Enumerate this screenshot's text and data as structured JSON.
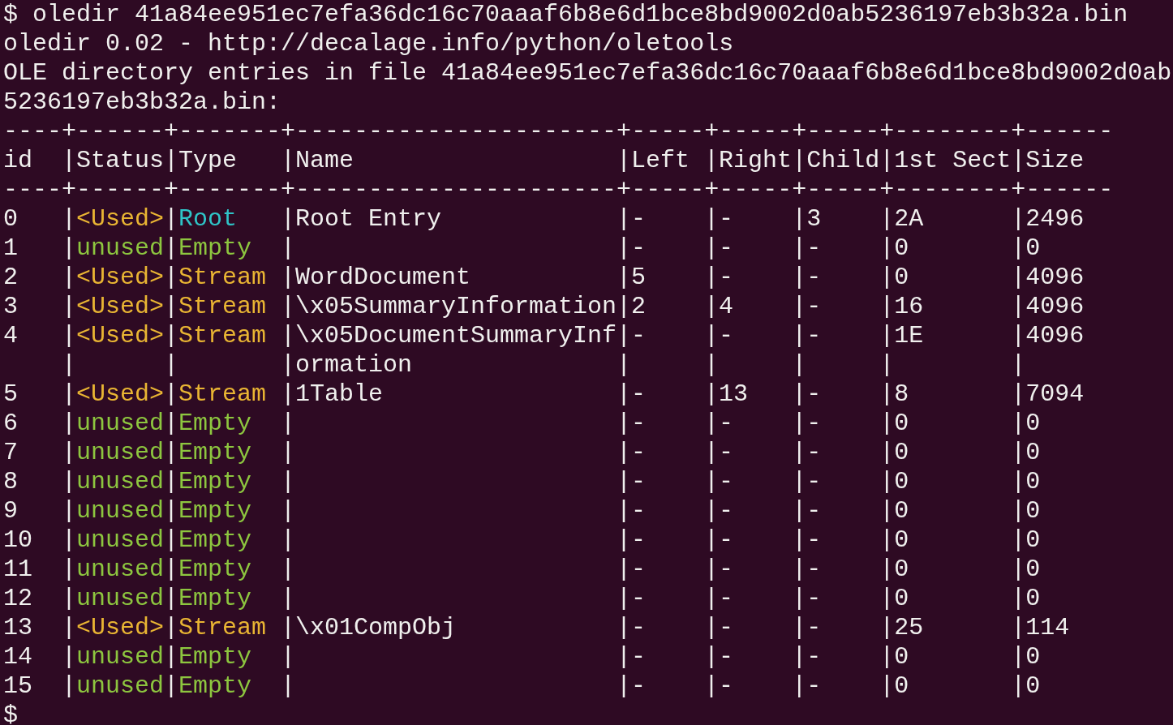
{
  "output_lines": [
    "$ oledir 41a84ee951ec7efa36dc16c70aaaf6b8e6d1bce8bd9002d0ab5236197eb3b32a.bin",
    "oledir 0.02 - http://decalage.info/python/oletools",
    "OLE directory entries in file 41a84ee951ec7efa36dc16c70aaaf6b8e6d1bce8bd9002d0ab",
    "5236197eb3b32a.bin:"
  ],
  "table": {
    "border_top": "----+------+-------+----------------------+-----+-----+-----+--------+------",
    "columns": [
      "id",
      "|Status",
      "|Type",
      "|Name",
      "|Left",
      "|Right",
      "|Child",
      "|1st Sect",
      "|Size"
    ],
    "border_bottom": "----+------+-------+----------------------+-----+-----+-----+--------+------",
    "rows": [
      {
        "cells": [
          "0",
          {
            "sep": "|",
            "text": "<Used>",
            "color": "#e9b533"
          },
          {
            "sep": "|",
            "text": "Root",
            "color": "#2fc5c8"
          },
          "|Root Entry",
          "|-",
          "|-",
          "|3",
          "|2A",
          "|2496"
        ]
      },
      {
        "cells": [
          "1",
          {
            "sep": "|",
            "text": "unused",
            "color": "#8dc63f"
          },
          {
            "sep": "|",
            "text": "Empty",
            "color": "#8dc63f"
          },
          "|",
          "|-",
          "|-",
          "|-",
          "|0",
          "|0"
        ]
      },
      {
        "cells": [
          "2",
          {
            "sep": "|",
            "text": "<Used>",
            "color": "#e9b533"
          },
          {
            "sep": "|",
            "text": "Stream",
            "color": "#e9b533"
          },
          "|WordDocument",
          "|5",
          "|-",
          "|-",
          "|0",
          "|4096"
        ]
      },
      {
        "cells": [
          "3",
          {
            "sep": "|",
            "text": "<Used>",
            "color": "#e9b533"
          },
          {
            "sep": "|",
            "text": "Stream",
            "color": "#e9b533"
          },
          "|\\x05SummaryInformation",
          "|2",
          "|4",
          "|-",
          "|16",
          "|4096"
        ]
      },
      {
        "cells": [
          "4",
          {
            "sep": "|",
            "text": "<Used>",
            "color": "#e9b533"
          },
          {
            "sep": "|",
            "text": "Stream",
            "color": "#e9b533"
          },
          "|\\x05DocumentSummaryInf",
          "|-",
          "|-",
          "|-",
          "|1E",
          "|4096"
        ]
      },
      {
        "cells": [
          null,
          "|",
          "|",
          "|ormation",
          "|",
          "|",
          "|",
          "|",
          "|"
        ]
      },
      {
        "cells": [
          "5",
          {
            "sep": "|",
            "text": "<Used>",
            "color": "#e9b533"
          },
          {
            "sep": "|",
            "text": "Stream",
            "color": "#e9b533"
          },
          "|1Table",
          "|-",
          "|13",
          "|-",
          "|8",
          "|7094"
        ]
      },
      {
        "cells": [
          "6",
          {
            "sep": "|",
            "text": "unused",
            "color": "#8dc63f"
          },
          {
            "sep": "|",
            "text": "Empty",
            "color": "#8dc63f"
          },
          "|",
          "|-",
          "|-",
          "|-",
          "|0",
          "|0"
        ]
      },
      {
        "cells": [
          "7",
          {
            "sep": "|",
            "text": "unused",
            "color": "#8dc63f"
          },
          {
            "sep": "|",
            "text": "Empty",
            "color": "#8dc63f"
          },
          "|",
          "|-",
          "|-",
          "|-",
          "|0",
          "|0"
        ]
      },
      {
        "cells": [
          "8",
          {
            "sep": "|",
            "text": "unused",
            "color": "#8dc63f"
          },
          {
            "sep": "|",
            "text": "Empty",
            "color": "#8dc63f"
          },
          "|",
          "|-",
          "|-",
          "|-",
          "|0",
          "|0"
        ]
      },
      {
        "cells": [
          "9",
          {
            "sep": "|",
            "text": "unused",
            "color": "#8dc63f"
          },
          {
            "sep": "|",
            "text": "Empty",
            "color": "#8dc63f"
          },
          "|",
          "|-",
          "|-",
          "|-",
          "|0",
          "|0"
        ]
      },
      {
        "cells": [
          "10",
          {
            "sep": "|",
            "text": "unused",
            "color": "#8dc63f"
          },
          {
            "sep": "|",
            "text": "Empty",
            "color": "#8dc63f"
          },
          "|",
          "|-",
          "|-",
          "|-",
          "|0",
          "|0"
        ]
      },
      {
        "cells": [
          "11",
          {
            "sep": "|",
            "text": "unused",
            "color": "#8dc63f"
          },
          {
            "sep": "|",
            "text": "Empty",
            "color": "#8dc63f"
          },
          "|",
          "|-",
          "|-",
          "|-",
          "|0",
          "|0"
        ]
      },
      {
        "cells": [
          "12",
          {
            "sep": "|",
            "text": "unused",
            "color": "#8dc63f"
          },
          {
            "sep": "|",
            "text": "Empty",
            "color": "#8dc63f"
          },
          "|",
          "|-",
          "|-",
          "|-",
          "|0",
          "|0"
        ]
      },
      {
        "cells": [
          "13",
          {
            "sep": "|",
            "text": "<Used>",
            "color": "#e9b533"
          },
          {
            "sep": "|",
            "text": "Stream",
            "color": "#e9b533"
          },
          "|\\x01CompObj",
          "|-",
          "|-",
          "|-",
          "|25",
          "|114"
        ]
      },
      {
        "cells": [
          "14",
          {
            "sep": "|",
            "text": "unused",
            "color": "#8dc63f"
          },
          {
            "sep": "|",
            "text": "Empty",
            "color": "#8dc63f"
          },
          "|",
          "|-",
          "|-",
          "|-",
          "|0",
          "|0"
        ]
      },
      {
        "cells": [
          "15",
          {
            "sep": "|",
            "text": "unused",
            "color": "#8dc63f"
          },
          {
            "sep": "|",
            "text": "Empty",
            "color": "#8dc63f"
          },
          "|",
          "|-",
          "|-",
          "|-",
          "|0",
          "|0"
        ]
      }
    ]
  },
  "prompt": "$"
}
